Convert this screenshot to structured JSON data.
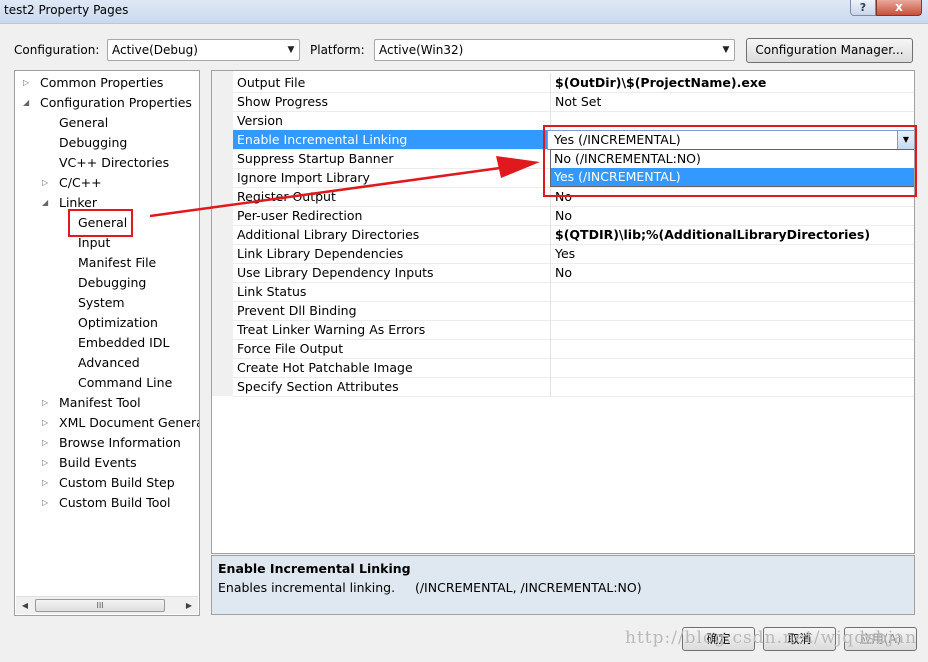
{
  "window": {
    "title": "test2 Property Pages",
    "help_glyph": "?",
    "close_glyph": "x"
  },
  "config_bar": {
    "configuration_label": "Configuration:",
    "configuration_value": "Active(Debug)",
    "platform_label": "Platform:",
    "platform_value": "Active(Win32)",
    "manager_button": "Configuration Manager..."
  },
  "tree": {
    "items": [
      {
        "label": "Common Properties",
        "twisty": "▷"
      },
      {
        "label": "Configuration Properties",
        "twisty": "◢"
      },
      {
        "label": "General",
        "twisty": ""
      },
      {
        "label": "Debugging",
        "twisty": ""
      },
      {
        "label": "VC++ Directories",
        "twisty": ""
      },
      {
        "label": "C/C++",
        "twisty": "▷"
      },
      {
        "label": "Linker",
        "twisty": "◢"
      },
      {
        "label": "General",
        "twisty": ""
      },
      {
        "label": "Input",
        "twisty": ""
      },
      {
        "label": "Manifest File",
        "twisty": ""
      },
      {
        "label": "Debugging",
        "twisty": ""
      },
      {
        "label": "System",
        "twisty": ""
      },
      {
        "label": "Optimization",
        "twisty": ""
      },
      {
        "label": "Embedded IDL",
        "twisty": ""
      },
      {
        "label": "Advanced",
        "twisty": ""
      },
      {
        "label": "Command Line",
        "twisty": ""
      },
      {
        "label": "Manifest Tool",
        "twisty": "▷"
      },
      {
        "label": "XML Document Generat",
        "twisty": "▷"
      },
      {
        "label": "Browse Information",
        "twisty": "▷"
      },
      {
        "label": "Build Events",
        "twisty": "▷"
      },
      {
        "label": "Custom Build Step",
        "twisty": "▷"
      },
      {
        "label": "Custom Build Tool",
        "twisty": "▷"
      }
    ],
    "scroll_left": "◀",
    "scroll_right": "▶",
    "scroll_thumb": "III"
  },
  "properties": [
    {
      "name": "Output File",
      "value": "$(OutDir)\\$(ProjectName).exe",
      "bold": true
    },
    {
      "name": "Show Progress",
      "value": "Not Set",
      "bold": false
    },
    {
      "name": "Version",
      "value": "",
      "bold": false
    },
    {
      "name": "Enable Incremental Linking",
      "value": "",
      "bold": false
    },
    {
      "name": "Suppress Startup Banner",
      "value": "",
      "bold": false
    },
    {
      "name": "Ignore Import Library",
      "value": "",
      "bold": false
    },
    {
      "name": "Register Output",
      "value": "No",
      "bold": false
    },
    {
      "name": "Per-user Redirection",
      "value": "No",
      "bold": false
    },
    {
      "name": "Additional Library Directories",
      "value": "$(QTDIR)\\lib;%(AdditionalLibraryDirectories)",
      "bold": true
    },
    {
      "name": "Link Library Dependencies",
      "value": "Yes",
      "bold": false
    },
    {
      "name": "Use Library Dependency Inputs",
      "value": "No",
      "bold": false
    },
    {
      "name": "Link Status",
      "value": "",
      "bold": false
    },
    {
      "name": "Prevent Dll Binding",
      "value": "",
      "bold": false
    },
    {
      "name": "Treat Linker Warning As Errors",
      "value": "",
      "bold": false
    },
    {
      "name": "Force File Output",
      "value": "",
      "bold": false
    },
    {
      "name": "Create Hot Patchable Image",
      "value": "",
      "bold": false
    },
    {
      "name": "Specify Section Attributes",
      "value": "",
      "bold": false
    }
  ],
  "dropdown": {
    "current": "Yes (/INCREMENTAL)",
    "options": [
      "No (/INCREMENTAL:NO)",
      "Yes (/INCREMENTAL)"
    ],
    "highlighted_index": 1
  },
  "description": {
    "title": "Enable Incremental Linking",
    "text": "Enables incremental linking.     (/INCREMENTAL, /INCREMENTAL:NO)"
  },
  "buttons": {
    "ok": "确定",
    "cancel": "取消",
    "apply": "应用(A)"
  },
  "watermark": "http://blog.csdn.net/wjqdsbjan",
  "colors": {
    "selection": "#3399ff",
    "annotation_red": "#e0191e"
  }
}
